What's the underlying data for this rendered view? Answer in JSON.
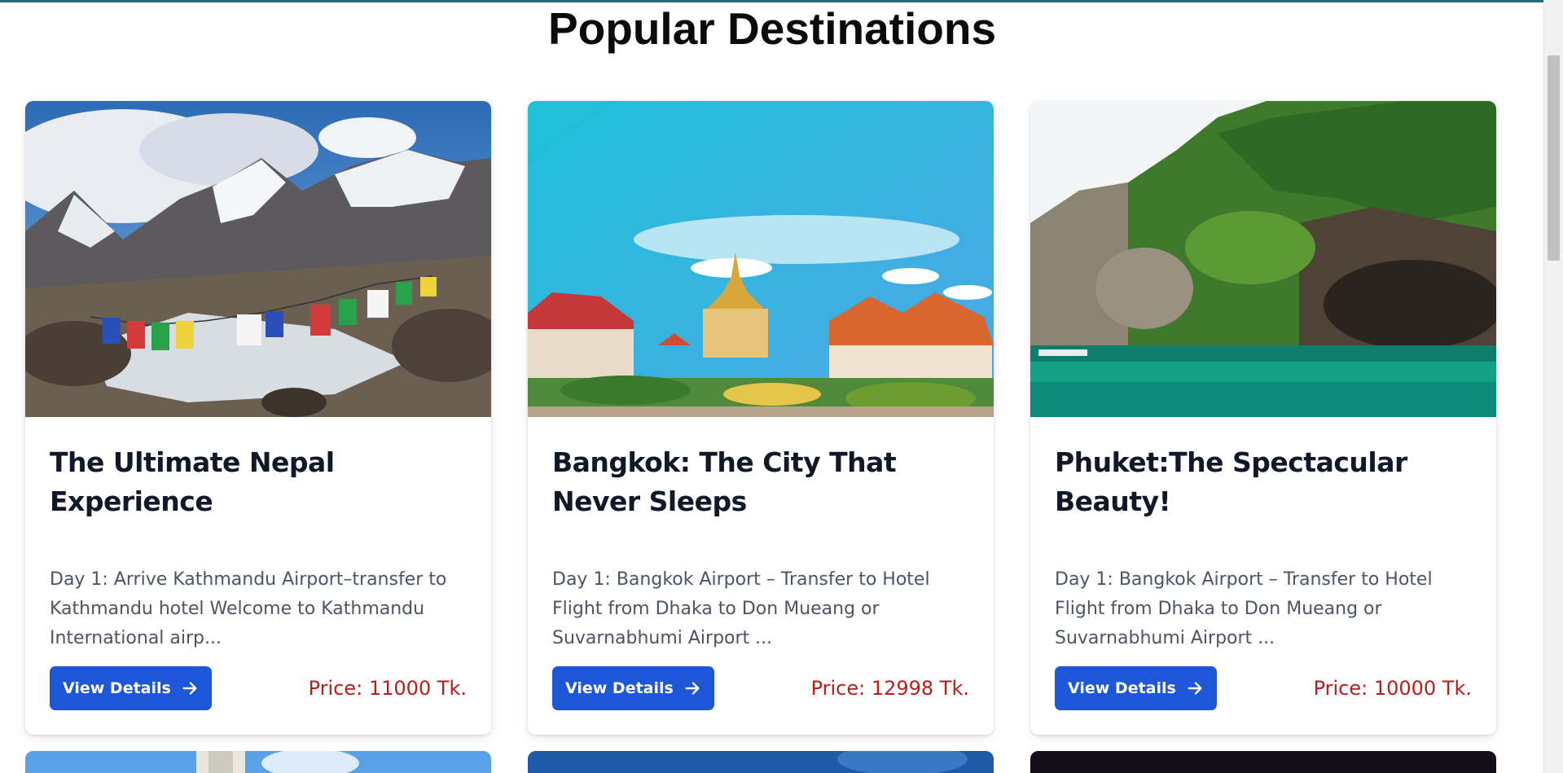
{
  "section": {
    "title": "Popular Destinations"
  },
  "cards": [
    {
      "title": "The Ultimate Nepal Experience",
      "description": "Day 1: Arrive Kathmandu Airport–transfer to Kathmandu hotel Welcome to Kathmandu International airp...",
      "button_label": "View Details",
      "price": "Price: 11000 Tk.",
      "image": "nepal-mountains-prayer-flags"
    },
    {
      "title": "Bangkok: The City That Never Sleeps",
      "description": "Day 1: Bangkok Airport – Transfer to Hotel Flight from Dhaka to Don Mueang or Suvarnabhumi Airport ...",
      "button_label": "View Details",
      "price": "Price: 12998 Tk.",
      "image": "bangkok-temple"
    },
    {
      "title": "Phuket:The Spectacular Beauty!",
      "description": "Day 1: Bangkok Airport – Transfer to Hotel Flight from Dhaka to Don Mueang or Suvarnabhumi Airport ...",
      "button_label": "View Details",
      "price": "Price: 10000 Tk.",
      "image": "phuket-cliffs-sea"
    }
  ],
  "colors": {
    "accent": "#1d56d6",
    "price": "#b91c1c",
    "title": "#111827",
    "text": "#4b5563"
  },
  "icons": {
    "button_icon": "arrow-right-icon"
  }
}
